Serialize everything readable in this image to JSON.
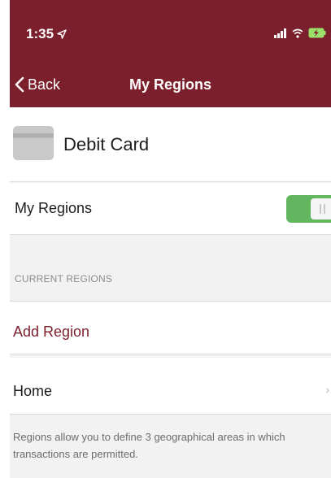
{
  "status_bar": {
    "time": "1:35",
    "icons": [
      "location-arrow-icon",
      "signal-icon",
      "wifi-icon",
      "battery-charging-icon"
    ]
  },
  "nav": {
    "back_label": "Back",
    "title": "My Regions"
  },
  "card": {
    "name": "Debit Card"
  },
  "toggle": {
    "label": "My Regions",
    "on": true,
    "color": "#63b65f"
  },
  "regions": {
    "section_title": "CURRENT REGIONS",
    "add_label": "Add Region",
    "items": [
      {
        "label": "Home"
      }
    ]
  },
  "footer_note": "Regions allow you to define 3 geographical areas in which transactions are permitted.",
  "colors": {
    "brand": "#7b1f2c",
    "background": "#f2f2f2"
  }
}
